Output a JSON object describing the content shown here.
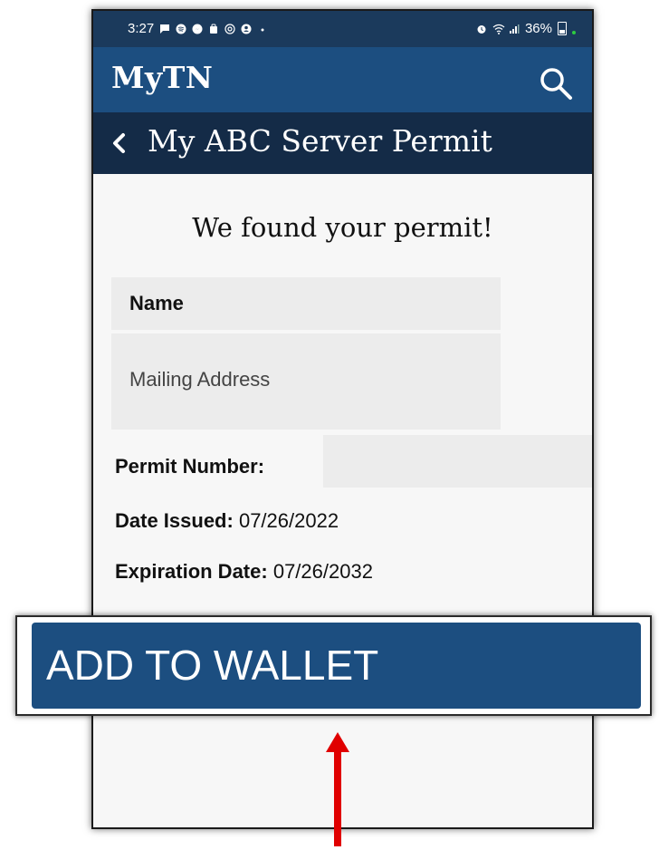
{
  "status_bar": {
    "time": "3:27",
    "battery_percent": "36%",
    "left_icons": [
      "message-icon",
      "spotify-icon",
      "messenger-icon",
      "shopping-bag-icon",
      "email-at-icon",
      "account-icon",
      "more-dot-icon"
    ],
    "right_icons": [
      "alarm-icon",
      "wifi-icon",
      "signal-icon",
      "battery-icon"
    ]
  },
  "app_bar": {
    "title": "MyTN",
    "search_icon": "search-icon"
  },
  "sub_header": {
    "back_icon": "chevron-left-icon",
    "title": "My ABC Server Permit"
  },
  "content": {
    "heading": "We found your permit!",
    "name_label": "Name",
    "address_label": "Mailing Address",
    "permit_number_label": "Permit Number:",
    "permit_number_value": "",
    "date_issued_label": "Date Issued:",
    "date_issued_value": "07/26/2022",
    "expiration_label": "Expiration Date:",
    "expiration_value": "07/26/2032"
  },
  "wallet_button": {
    "label": "ADD TO WALLET"
  },
  "colors": {
    "status_bar": "#1b3a5c",
    "app_bar": "#1c4e80",
    "sub_header": "#142b47",
    "button": "#1c4e80",
    "arrow": "#e00000",
    "content_bg": "#f7f7f7",
    "field_bg": "#ececec"
  }
}
